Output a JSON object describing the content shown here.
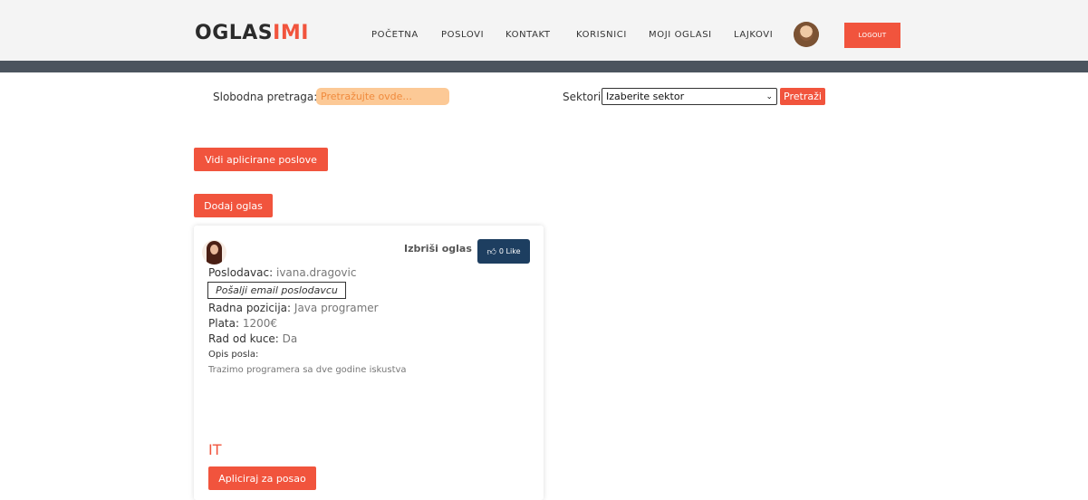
{
  "header": {
    "logo_part1": "OGLAS",
    "logo_part2": "IMI",
    "nav": [
      "POČETNA",
      "POSLOVI",
      "KONTAKT",
      "KORISNICI",
      "MOJI OGLASI",
      "LAJKOVI"
    ],
    "logout_label": "LOGOUT"
  },
  "search": {
    "free_search_label": "Slobodna pretraga:",
    "free_search_placeholder": "Pretražujte ovde...",
    "sector_label": "Sektori:",
    "sector_selected": "Izaberite sektor",
    "search_button": "Pretraži"
  },
  "actions": {
    "applied_jobs_label": "Vidi aplicirane poslove",
    "add_ad_label": "Dodaj oglas"
  },
  "card": {
    "delete_label": "Izbriši oglas",
    "like_label": "0 Like",
    "employer_label": "Poslodavac:",
    "employer_value": "ivana.dragovic",
    "email_button": "Pošalji email poslodavcu",
    "position_label": "Radna pozicija:",
    "position_value": "Java programer",
    "salary_label": "Plata:",
    "salary_value": "1200€",
    "remote_label": "Rad od kuce:",
    "remote_value": "Da",
    "description_label": "Opis posla:",
    "description_value": "Trazimo programera sa dve godine iskustva",
    "sector": "IT",
    "apply_label": "Apliciraj za posao"
  },
  "colors": {
    "accent": "#f1543d",
    "header_bar": "#4b545e",
    "like_button": "#1d3e60",
    "search_input": "#fcc996"
  }
}
